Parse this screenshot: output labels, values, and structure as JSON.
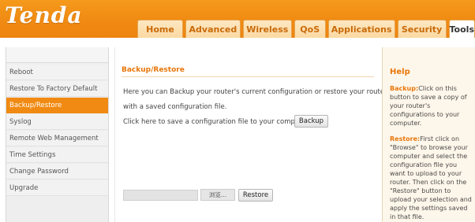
{
  "header": {
    "logo": "Tenda",
    "tabs": [
      "Home",
      "Advanced",
      "Wireless",
      "QoS",
      "Applications",
      "Security",
      "Tools"
    ],
    "active_tab": "Tools"
  },
  "sidebar": {
    "items": [
      {
        "label": "Reboot"
      },
      {
        "label": "Restore To Factory Default"
      },
      {
        "label": "Backup/Restore",
        "active": true
      },
      {
        "label": "Syslog"
      },
      {
        "label": "Remote Web Management"
      },
      {
        "label": "Time Settings"
      },
      {
        "label": "Change Password"
      },
      {
        "label": "Upgrade"
      }
    ]
  },
  "main": {
    "title": "Backup/Restore",
    "desc_line1": "Here you can Backup your router's current configuration or restore your router",
    "desc_line2": "with a saved configuration file.",
    "save_prompt": "Click here to save a configuration file to your computer:",
    "backup_button": "Backup",
    "file_value": "",
    "browse_button": "浏览...",
    "restore_button": "Restore"
  },
  "help": {
    "title": "Help",
    "backup_key": "Backup:",
    "backup_text": "Click on this button to save a copy of your router's configurations to your computer.",
    "restore_key": "Restore:",
    "restore_text": "First click on \"Browse\" to browse your computer and select the configuration file you want to upload to your router. Then click on the \"Restore\" button to upload your selection and apply the settings saved in that file."
  },
  "colors": {
    "accent": "#f08a12",
    "title": "#e8760a",
    "help_bg": "#fdf6ea"
  }
}
